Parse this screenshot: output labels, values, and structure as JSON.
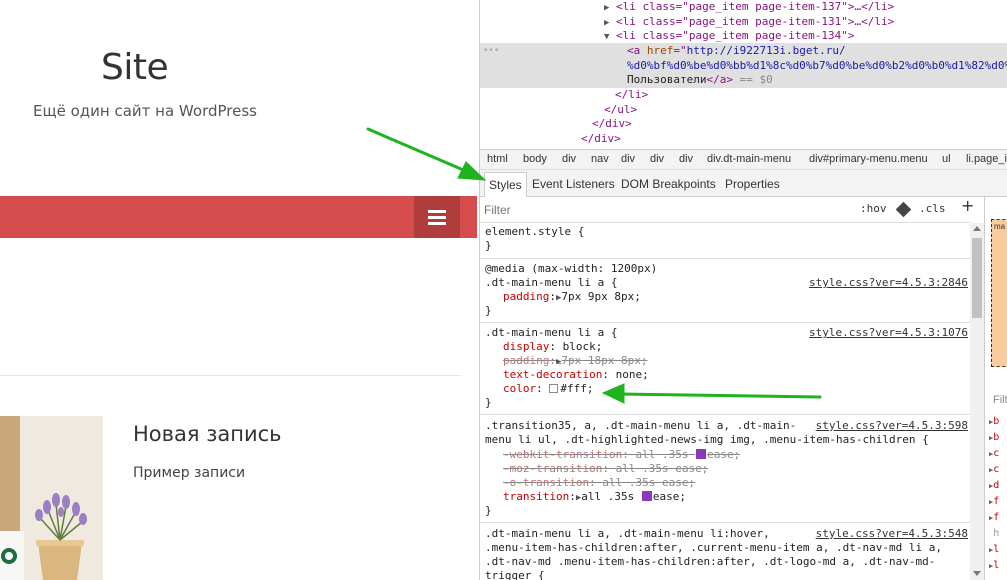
{
  "site": {
    "title": "Site",
    "description": "Ещё один сайт на WordPress",
    "post_title": "Новая запись",
    "post_excerpt": "Пример записи"
  },
  "dom_tree": {
    "lines": [
      "<li class=\"page_item page-item-137\">…</li>",
      "<li class=\"page_item page-item-131\">…</li>",
      "<li class=\"page_item page-item-134\">"
    ],
    "selected_href_1": "http://i922713i.bget.ru/",
    "selected_href_2": "%d0%bf%d0%be%d0%bb%d1%8c%d0%b7%d0%be%d0%b2%d0%b0%d1%82%d0%b5%d0",
    "selected_text": "Пользователи",
    "selected_suffix": "== $0",
    "closing": [
      "</li>",
      "</ul>",
      "</div>",
      "</div>"
    ]
  },
  "breadcrumbs": [
    "html",
    "body",
    "div",
    "nav",
    "div",
    "div",
    "div",
    "div.dt-main-menu",
    "div#primary-menu.menu",
    "ul",
    "li.page_it"
  ],
  "subtabs": {
    "styles": "Styles",
    "event_listeners": "Event Listeners",
    "dom_breakpoints": "DOM Breakpoints",
    "properties": "Properties"
  },
  "filter": {
    "placeholder": "Filter",
    "hov": ":hov",
    "cls": ".cls",
    "plus": "+"
  },
  "rules": {
    "r1": {
      "line1": "element.style {",
      "line2": "}"
    },
    "r2": {
      "media": "@media (max-width: 1200px)",
      "selector": ".dt-main-menu li a {",
      "source": "style.css?ver=4.5.3:2846",
      "p1_name": "padding",
      "p1_value": "7px 9px 8px;",
      "close": "}"
    },
    "r3": {
      "selector": ".dt-main-menu li a {",
      "source": "style.css?ver=4.5.3:1076",
      "p1_name": "display",
      "p1_value": "block;",
      "p2_name": "padding",
      "p2_value": "7px 18px 8px;",
      "p3_name": "text-decoration",
      "p3_value": "none;",
      "p4_name": "color",
      "p4_value": "#fff;",
      "close": "}"
    },
    "r4": {
      "selector_1": ".transition35, a, .dt-main-menu li a, .dt-main-",
      "selector_2": "menu li ul, .dt-highlighted-news-img img, .menu-item-has-children {",
      "source": "style.css?ver=4.5.3:598",
      "p1_name": "-webkit-transition",
      "p1_value_a": "all .35s",
      "p1_value_b": "ease;",
      "p2_name": "-moz-transition",
      "p2_value": "all .35s ease;",
      "p3_name": "-o-transition",
      "p3_value": "all .35s ease;",
      "p4_name": "transition",
      "p4_value_a": "all .35s",
      "p4_value_b": "ease;",
      "close": "}"
    },
    "r5": {
      "selector_1": ".dt-main-menu li a, .dt-main-menu li:hover,",
      "selector_2": ".menu-item-has-children:after, .current-menu-item a, .dt-nav-md li a,",
      "selector_3": ".dt-nav-md .menu-item-has-children:after, .dt-logo-md a, .dt-nav-md-",
      "selector_4": "trigger {",
      "source": "style.css?ver=4.5.3:548"
    }
  },
  "computed": {
    "box_label": "ma",
    "filter": "Filte",
    "props": [
      "b",
      "b",
      "c",
      "c",
      "d",
      "f",
      "f",
      "h",
      "l",
      "l"
    ]
  },
  "colors": {
    "navbar": "#d54c4c",
    "menu_button": "#b03c3c",
    "arrow": "#1db41d",
    "selected_row": "#e0e0e0"
  }
}
